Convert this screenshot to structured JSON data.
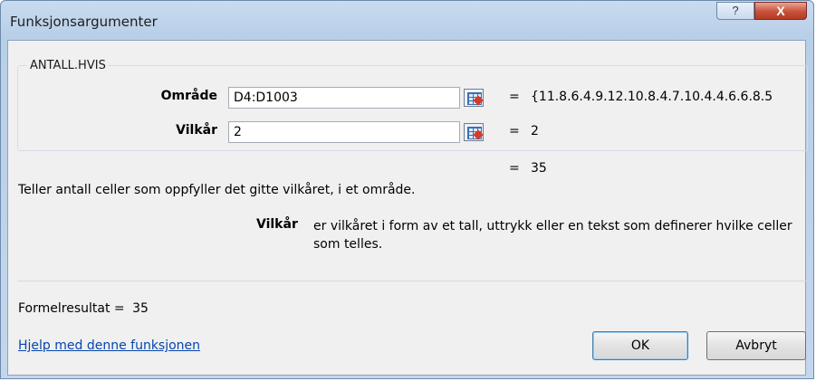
{
  "window": {
    "title": "Funksjonsargumenter",
    "help_glyph": "?",
    "close_glyph": "X"
  },
  "function": {
    "name": "ANTALL.HVIS",
    "args": [
      {
        "label": "Område",
        "value": "D4:D1003",
        "equals": "=",
        "result": "{11.8.6.4.9.12.10.8.4.7.10.4.4.6.6.8.5"
      },
      {
        "label": "Vilkår",
        "value": "2",
        "equals": "=",
        "result": "2"
      }
    ],
    "result_equals": "=",
    "result": "35",
    "description": "Teller antall celler som oppfyller det gitte vilkåret, i et område.",
    "arg_help_name": "Vilkår",
    "arg_help_text": "er vilkåret i form av et tall, uttrykk eller en tekst som definerer hvilke celler som telles."
  },
  "footer": {
    "formula_label": "Formelresultat =",
    "formula_value": "35",
    "help_link": "Hjelp med denne funksjonen",
    "ok": "OK",
    "cancel": "Avbryt"
  },
  "colors": {
    "link": "#0645ad",
    "close": "#c8513b",
    "titlebar": "#c9dbef"
  },
  "icons": {
    "ref": "collapse-dialog-icon"
  }
}
